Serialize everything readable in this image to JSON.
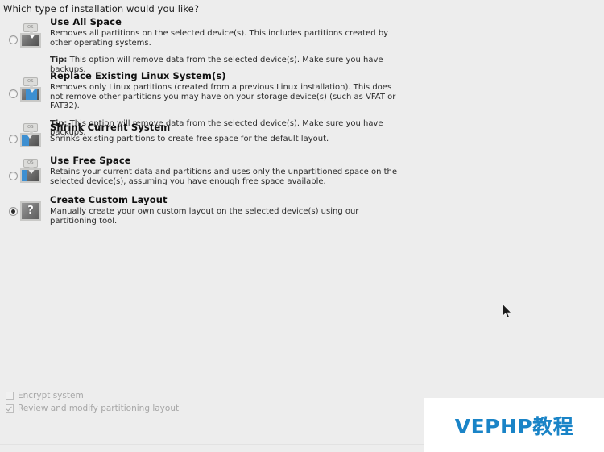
{
  "page": {
    "title": "Which type of installation would you like?",
    "background_color": "#ededed"
  },
  "options": [
    {
      "id": "use-all-space",
      "title": "Use All Space",
      "description": "Removes all partitions on the selected device(s).  This includes partitions created by other operating systems.",
      "tip_label": "Tip:",
      "tip_text": " This option will remove data from the selected device(s).  Make sure you have backups.",
      "selected": false,
      "icon": "disk-erase-icon",
      "icon_tag": "OS"
    },
    {
      "id": "replace-existing-linux",
      "title": "Replace Existing Linux System(s)",
      "description": "Removes only Linux partitions (created from a previous Linux installation).  This does not remove other partitions you may have on your storage device(s) (such as VFAT or FAT32).",
      "tip_label": "Tip:",
      "tip_text": " This option will remove data from the selected device(s).  Make sure you have backups.",
      "selected": false,
      "icon": "disk-replace-icon",
      "icon_tag": "OS"
    },
    {
      "id": "shrink-current-system",
      "title": "Shrink Current System",
      "description": "Shrinks existing partitions to create free space for the default layout.",
      "tip_label": "",
      "tip_text": "",
      "selected": false,
      "icon": "disk-shrink-icon",
      "icon_tag": "OS"
    },
    {
      "id": "use-free-space",
      "title": "Use Free Space",
      "description": "Retains your current data and partitions and uses only the unpartitioned space on the selected device(s), assuming you have enough free space available.",
      "tip_label": "",
      "tip_text": "",
      "selected": false,
      "icon": "disk-free-space-icon",
      "icon_tag": "OS"
    },
    {
      "id": "create-custom-layout",
      "title": "Create Custom Layout",
      "description": "Manually create your own custom layout on the selected device(s) using our partitioning tool.",
      "tip_label": "",
      "tip_text": "",
      "selected": true,
      "icon": "disk-question-icon",
      "icon_tag": "?"
    }
  ],
  "bottom_options": [
    {
      "id": "encrypt-system",
      "label": "Encrypt system",
      "checked": false,
      "disabled": true
    },
    {
      "id": "review-modify-partitioning",
      "label": "Review and modify partitioning layout",
      "checked": true,
      "disabled": true
    }
  ],
  "watermark": {
    "text": "VEPHP教程",
    "color": "#1a84c7",
    "background": "#ffffff"
  }
}
